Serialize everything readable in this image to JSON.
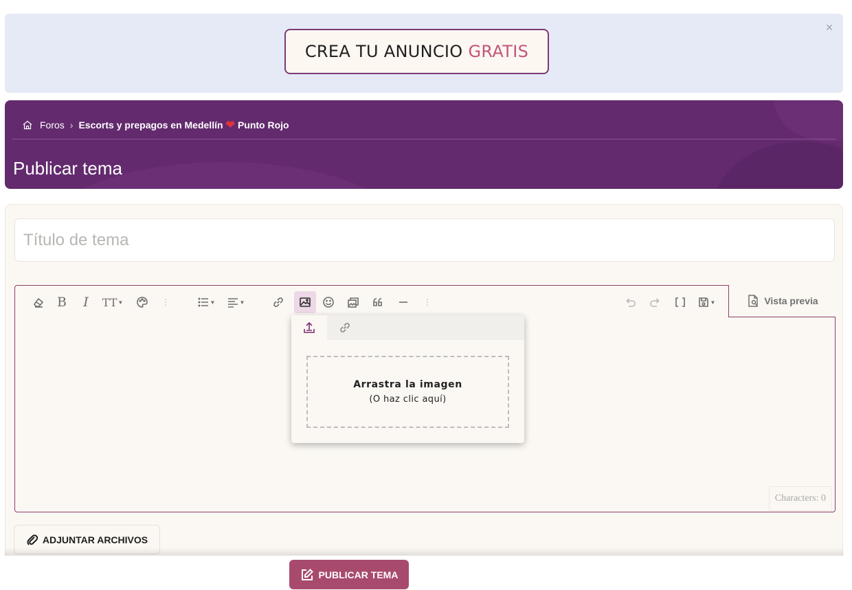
{
  "ad": {
    "text_main": "CREA TU ANUNCIO",
    "text_accent": "GRATIS",
    "close_icon": "close-icon",
    "accent_color": "#c2547a"
  },
  "header": {
    "breadcrumb": {
      "home_icon": "home-icon",
      "forum_label": "Foros",
      "current_label_start": "Escorts y prepagos en Medellín",
      "current_label_end": "Punto Rojo",
      "heart_icon": "heart-icon"
    },
    "title": "Publicar tema",
    "bg_color": "#632a6e"
  },
  "form": {
    "title_placeholder": "Título de tema",
    "title_value": ""
  },
  "editor": {
    "toolbar": {
      "items": [
        "remove-format",
        "bold",
        "italic",
        "text-size",
        "text-color",
        "more-text",
        "list",
        "align",
        "link",
        "insert-image",
        "emoji",
        "media-gallery",
        "quote",
        "horizontal-line",
        "more-insert",
        "undo",
        "redo",
        "bb-code",
        "drafts"
      ],
      "bold_label": "B",
      "italic_label": "I",
      "size_label": "TT"
    },
    "preview_label": "Vista previa",
    "char_count": "Characters: 0",
    "image_popup": {
      "tabs": [
        "upload-icon",
        "link-icon"
      ],
      "drop_main": "Arrastra la imagen",
      "drop_sub": "(O haz clic aquí)"
    }
  },
  "attach_label": "ADJUNTAR ARCHIVOS",
  "publish_label": "PUBLICAR TEMA",
  "publish_color": "#a84a6e"
}
